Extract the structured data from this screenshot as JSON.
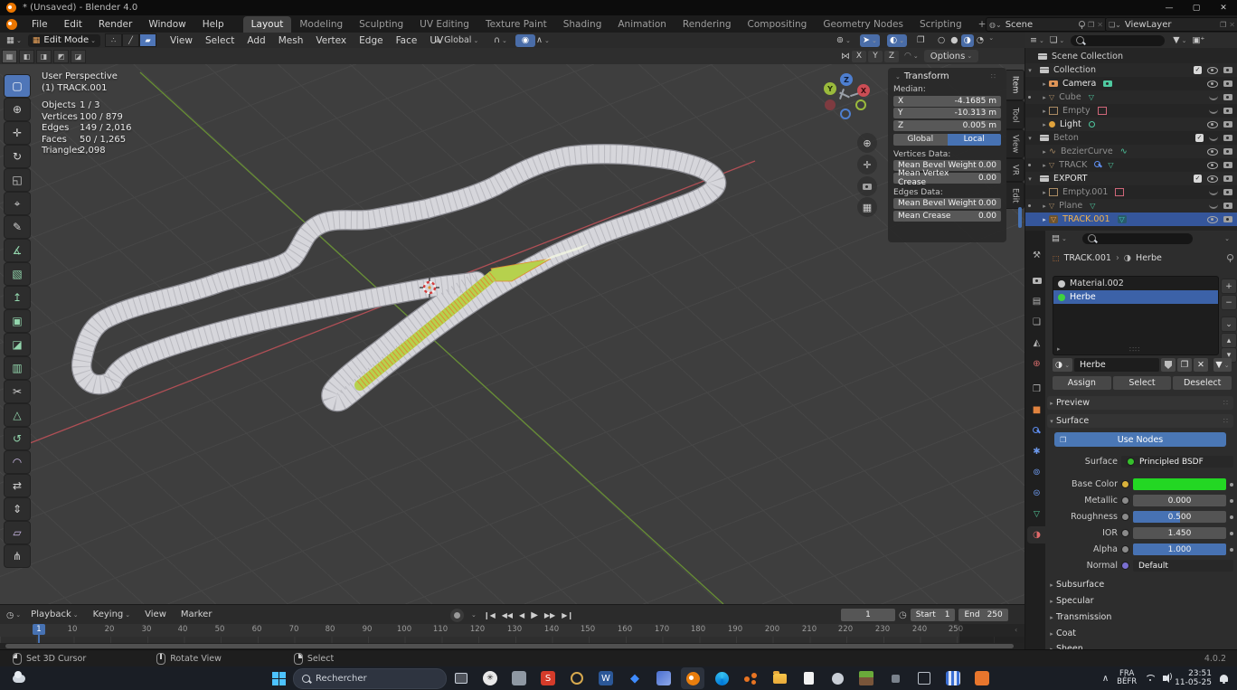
{
  "window": {
    "title": "* (Unsaved) - Blender 4.0"
  },
  "topbar": {
    "menus": [
      "File",
      "Edit",
      "Render",
      "Window",
      "Help"
    ],
    "workspaces": [
      "Layout",
      "Modeling",
      "Sculpting",
      "UV Editing",
      "Texture Paint",
      "Shading",
      "Animation",
      "Rendering",
      "Compositing",
      "Geometry Nodes",
      "Scripting"
    ],
    "add_workspace": "+",
    "scene_label": "Scene",
    "viewlayer_label": "ViewLayer"
  },
  "viewport": {
    "header": {
      "mode": "Edit Mode",
      "menus": [
        "View",
        "Select",
        "Add",
        "Mesh",
        "Vertex",
        "Edge",
        "Face",
        "UV"
      ],
      "orientation": "Global"
    },
    "tool_settings": {
      "axes": [
        "X",
        "Y",
        "Z"
      ],
      "options_label": "Options"
    },
    "stats": {
      "view": "User Perspective",
      "active_object": "(1) TRACK.001",
      "rows": [
        {
          "label": "Objects",
          "value": "1 / 3"
        },
        {
          "label": "Vertices",
          "value": "100 / 879"
        },
        {
          "label": "Edges",
          "value": "149 / 2,016"
        },
        {
          "label": "Faces",
          "value": "50 / 1,265"
        },
        {
          "label": "Triangles",
          "value": "2,098"
        }
      ]
    },
    "gizmo": {
      "x": "X",
      "y": "Y",
      "z": "Z"
    }
  },
  "tools": [
    {
      "name": "select-box",
      "glyph": "▢"
    },
    {
      "name": "cursor",
      "glyph": "⊕"
    },
    {
      "name": "move",
      "glyph": "✛"
    },
    {
      "name": "rotate",
      "glyph": "↻"
    },
    {
      "name": "scale",
      "glyph": "◱"
    },
    {
      "name": "transform",
      "glyph": "⌖"
    },
    {
      "name": "annotate",
      "glyph": "✎"
    },
    {
      "name": "measure",
      "glyph": "∡"
    },
    {
      "name": "add-cube",
      "glyph": "▧"
    },
    {
      "name": "extrude-region",
      "glyph": "↥"
    },
    {
      "name": "inset-faces",
      "glyph": "▣"
    },
    {
      "name": "bevel",
      "glyph": "◪"
    },
    {
      "name": "loop-cut",
      "glyph": "▥"
    },
    {
      "name": "knife",
      "glyph": "✂"
    },
    {
      "name": "poly-build",
      "glyph": "△"
    },
    {
      "name": "spin",
      "glyph": "↺"
    },
    {
      "name": "smooth",
      "glyph": "◠"
    },
    {
      "name": "edge-slide",
      "glyph": "⇄"
    },
    {
      "name": "shrink-fatten",
      "glyph": "⇕"
    },
    {
      "name": "shear",
      "glyph": "▱"
    },
    {
      "name": "rip-region",
      "glyph": "⋔"
    }
  ],
  "sidebar": {
    "tabs": [
      "Item",
      "Tool",
      "View",
      "VR",
      "Edit"
    ],
    "transform": {
      "title": "Transform",
      "median_label": "Median:",
      "fields": [
        {
          "label": "X",
          "value": "-4.1685 m"
        },
        {
          "label": "Y",
          "value": "-10.313 m"
        },
        {
          "label": "Z",
          "value": "0.005 m"
        }
      ],
      "global_label": "Global",
      "local_label": "Local",
      "vertices_label": "Vertices Data:",
      "vertex_rows": [
        {
          "label": "Mean Bevel Weight",
          "value": "0.00"
        },
        {
          "label": "Mean Vertex Crease",
          "value": "0.00"
        }
      ],
      "edges_label": "Edges Data:",
      "edge_rows": [
        {
          "label": "Mean Bevel Weight",
          "value": "0.00"
        },
        {
          "label": "Mean Crease",
          "value": "0.00"
        }
      ]
    }
  },
  "outliner": {
    "rows": [
      {
        "label": "Scene Collection"
      },
      {
        "label": "Collection"
      },
      {
        "label": "Camera"
      },
      {
        "label": "Cube"
      },
      {
        "label": "Empty"
      },
      {
        "label": "Light"
      },
      {
        "label": "Beton"
      },
      {
        "label": "BezierCurve"
      },
      {
        "label": "TRACK"
      },
      {
        "label": "EXPORT"
      },
      {
        "label": "Empty.001"
      },
      {
        "label": "Plane"
      },
      {
        "label": "TRACK.001"
      }
    ]
  },
  "properties": {
    "breadcrumb": {
      "object": "TRACK.001",
      "separator": "›",
      "material": "Herbe"
    },
    "slots": [
      {
        "name": "Material.002"
      },
      {
        "name": "Herbe"
      }
    ],
    "name_field": "Herbe",
    "actions": [
      "Assign",
      "Select",
      "Deselect"
    ],
    "preview_label": "Preview",
    "surface_label": "Surface",
    "use_nodes": "Use Nodes",
    "surface_row": {
      "label": "Surface",
      "value": "Principled BSDF"
    },
    "rows": [
      {
        "label": "Base Color",
        "value": ""
      },
      {
        "label": "Metallic",
        "value": "0.000"
      },
      {
        "label": "Roughness",
        "value": "0.500"
      },
      {
        "label": "IOR",
        "value": "1.450"
      },
      {
        "label": "Alpha",
        "value": "1.000"
      },
      {
        "label": "Normal",
        "value": "Default"
      }
    ],
    "collapsed": [
      "Subsurface",
      "Specular",
      "Transmission",
      "Coat",
      "Sheen"
    ]
  },
  "timeline": {
    "menus": [
      "Playback",
      "Keying",
      "View",
      "Marker"
    ],
    "current_frame": "1",
    "ticks": [
      "10",
      "20",
      "30",
      "40",
      "50",
      "60",
      "70",
      "80",
      "90",
      "100",
      "110",
      "120",
      "130",
      "140",
      "150",
      "160",
      "170",
      "180",
      "190",
      "200",
      "210",
      "220",
      "230",
      "240",
      "250"
    ],
    "start_label": "Start",
    "start_value": "1",
    "end_label": "End",
    "end_value": "250"
  },
  "status_bar": {
    "hints": [
      "Set 3D Cursor",
      "Rotate View",
      "Select"
    ],
    "version": "4.0.2"
  },
  "taskbar": {
    "search_placeholder": "Rechercher",
    "glyphs": {
      "sumatra": "S",
      "word": "W",
      "chatgpt": "✳",
      "gem": "◆"
    },
    "tray": {
      "lang": "FRA",
      "layout": "BÉFR",
      "time": "23:51",
      "date": "11-05-25"
    }
  },
  "colors": {
    "accent": "#4772b3",
    "selected_text": "#f0b14e",
    "base_color_green": "#23d723",
    "grass": "#b6d14d",
    "axis_x": "#c4525a",
    "axis_y": "#6f9d33"
  }
}
